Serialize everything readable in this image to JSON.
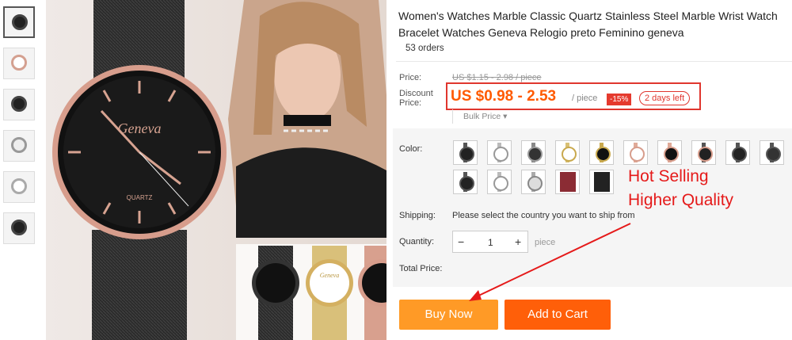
{
  "product": {
    "title": "Women's Watches Marble Classic Quartz Stainless Steel Marble Wrist Watch Bracelet Watches Geneva Relogio preto Feminino geneva",
    "orders": "53 orders"
  },
  "pricing": {
    "price_label": "Price:",
    "original_price": "US $1.15 - 2.98 / piece",
    "discount_label": "Discount Price:",
    "discount_price": "US $0.98 - 2.53",
    "per_unit": "/ piece",
    "discount_percent": "-15%",
    "time_left": "2 days left",
    "bulk_price": "Bulk Price ▾"
  },
  "options": {
    "color_label": "Color:",
    "shipping_label": "Shipping:",
    "shipping_text": "Please select the country you want to ship from",
    "quantity_label": "Quantity:",
    "quantity_value": "1",
    "quantity_unit": "piece",
    "total_label": "Total Price:",
    "minus": "−",
    "plus": "+"
  },
  "hero": {
    "brand": "Geneva",
    "movement": "QUARTZ"
  },
  "promo": {
    "line1": "Hot Selling",
    "line2": "Higher Quality"
  },
  "actions": {
    "buy_now": "Buy Now",
    "add_to_cart": "Add to Cart"
  },
  "colors": {
    "accent_orange": "#ff5a00",
    "buy_button": "#ff9a26",
    "cart_button": "#ff5f09",
    "highlight_red": "#e0362e"
  }
}
